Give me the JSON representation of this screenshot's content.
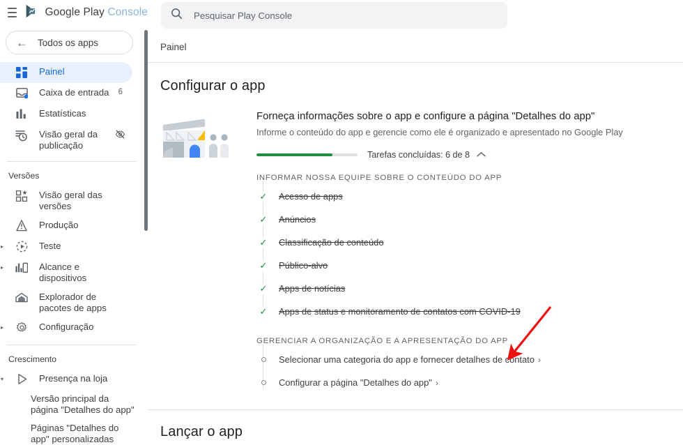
{
  "brand": {
    "menu_icon": "hamburger-icon",
    "logo_icon": "google-play-console-logo",
    "name_primary": "Google Play",
    "name_secondary": "Console"
  },
  "all_apps_button": {
    "icon": "back-arrow-icon",
    "label": "Todos os apps"
  },
  "sidebar": {
    "items": [
      {
        "icon": "dashboard-icon",
        "label": "Painel",
        "badge": "",
        "active": true,
        "expandable": false
      },
      {
        "icon": "inbox-icon",
        "label": "Caixa de entrada",
        "badge": "6",
        "active": false,
        "expandable": false
      },
      {
        "icon": "statistics-icon",
        "label": "Estatísticas",
        "badge": "",
        "active": false,
        "expandable": false
      },
      {
        "icon": "publishing-overview-icon",
        "label": "Visão geral da publicação",
        "badge": "",
        "trail_icon": "eye-off-icon",
        "active": false,
        "expandable": false
      }
    ],
    "group_versions": {
      "title": "Versões",
      "items": [
        {
          "icon": "releases-overview-icon",
          "label": "Visão geral das versões",
          "expandable": false
        },
        {
          "icon": "production-icon",
          "label": "Produção",
          "expandable": false
        },
        {
          "icon": "testing-icon",
          "label": "Teste",
          "expandable": true
        },
        {
          "icon": "reach-devices-icon",
          "label": "Alcance e dispositivos",
          "expandable": true
        },
        {
          "icon": "app-bundle-explorer-icon",
          "label": "Explorador de pacotes de apps",
          "expandable": false
        },
        {
          "icon": "setup-gear-icon",
          "label": "Configuração",
          "expandable": true
        }
      ]
    },
    "group_growth": {
      "title": "Crescimento",
      "items": [
        {
          "icon": "store-presence-icon",
          "label": "Presença na loja",
          "expandable": true
        }
      ],
      "subitems": [
        {
          "label": "Versão principal da página \"Detalhes do app\""
        },
        {
          "label": "Páginas \"Detalhes do app\" personalizadas"
        }
      ]
    },
    "scrollbar": {
      "name": "sidebar-scrollbar"
    }
  },
  "search": {
    "icon": "search-icon",
    "placeholder": "Pesquisar Play Console"
  },
  "breadcrumb": "Painel",
  "main": {
    "section_title": "Configurar o app",
    "card": {
      "illustration": "storefront-illustration",
      "heading": "Forneça informações sobre o app e configure a página \"Detalhes do app\"",
      "subheading": "Informe o conteúdo do app e gerencie como ele é organizado e apresentado no Google Play",
      "progress": {
        "percent": 75,
        "label": "Tarefas concluídas: 6 de 8",
        "completed": 6,
        "total": 8,
        "collapse_icon": "chevron-up-icon",
        "fill_color": "#1e8e3e",
        "track_color": "#e0e0e0"
      },
      "groups": [
        {
          "title": "INFORMAR NOSSA EQUIPE SOBRE O CONTEÚDO DO APP",
          "tasks": [
            {
              "label": "Acesso de apps",
              "done": true
            },
            {
              "label": "Anúncios",
              "done": true
            },
            {
              "label": "Classificação de conteúdo",
              "done": true
            },
            {
              "label": "Público-alvo",
              "done": true
            },
            {
              "label": "Apps de notícias",
              "done": true
            },
            {
              "label": "Apps de status e monitoramento de contatos com COVID-19",
              "done": true
            }
          ]
        },
        {
          "title": "GERENCIAR A ORGANIZAÇÃO E A APRESENTAÇÃO DO APP",
          "tasks": [
            {
              "label": "Selecionar uma categoria do app e fornecer detalhes de contato",
              "done": false,
              "chevron": "›"
            },
            {
              "label": "Configurar a página \"Detalhes do app\"",
              "done": false,
              "chevron": "›"
            }
          ]
        }
      ]
    },
    "section_title_2": "Lançar o app"
  },
  "annotation": {
    "arrow": "red-arrow-pointer",
    "color": "#ee1111"
  }
}
